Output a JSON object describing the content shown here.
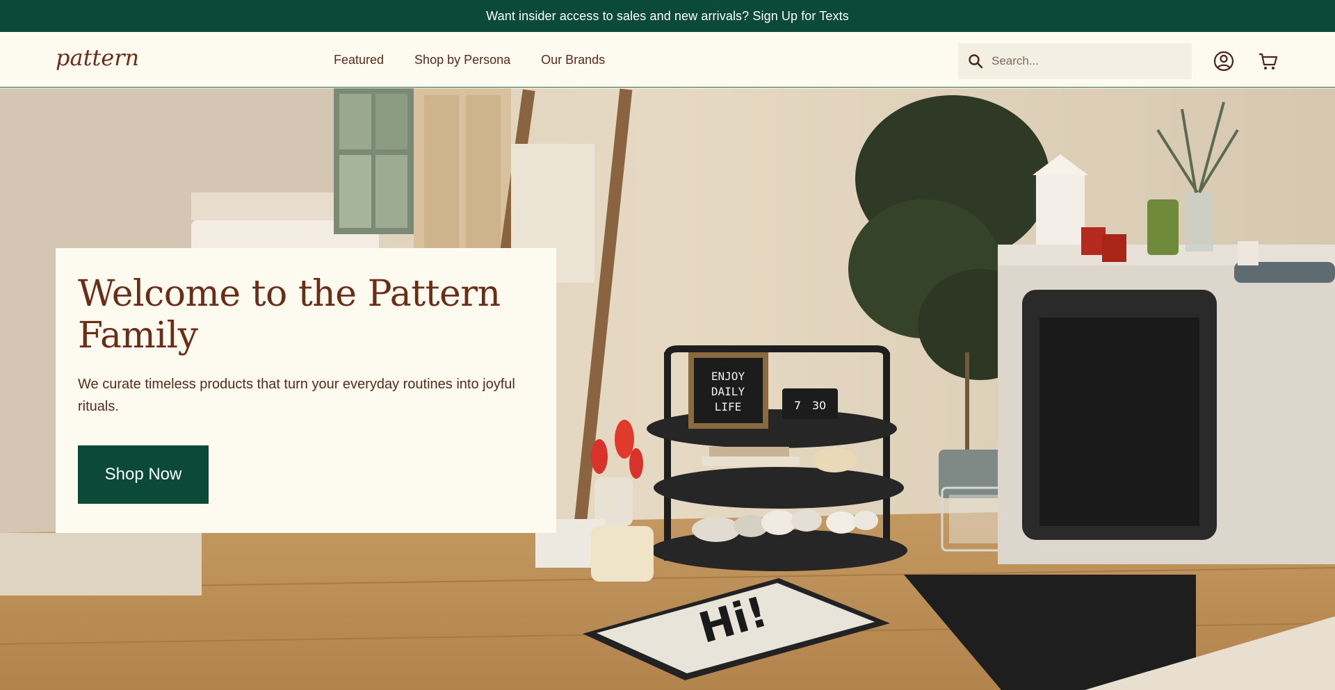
{
  "announcement": {
    "text": "Want insider access to sales and new arrivals? Sign Up for Texts"
  },
  "header": {
    "logo_text": "pattern",
    "nav": [
      {
        "label": "Featured"
      },
      {
        "label": "Shop by Persona"
      },
      {
        "label": "Our Brands"
      }
    ],
    "search": {
      "placeholder": "Search...",
      "value": ""
    },
    "icons": [
      "search-icon",
      "account-icon",
      "cart-icon"
    ]
  },
  "hero": {
    "title": "Welcome to the Pattern Family",
    "text": "We curate timeless products that turn your everyday routines into joyful rituals.",
    "cta_label": "Shop Now",
    "scene": {
      "letterboard": [
        "ENJOY",
        "DAILY",
        "LIFE"
      ],
      "clock_hour": "7",
      "clock_minute": "30",
      "mat_text": "Hi!"
    }
  },
  "colors": {
    "brand_green": "#0a4a36",
    "brand_brown": "#6b2d15",
    "cream": "#fdfaf0"
  }
}
